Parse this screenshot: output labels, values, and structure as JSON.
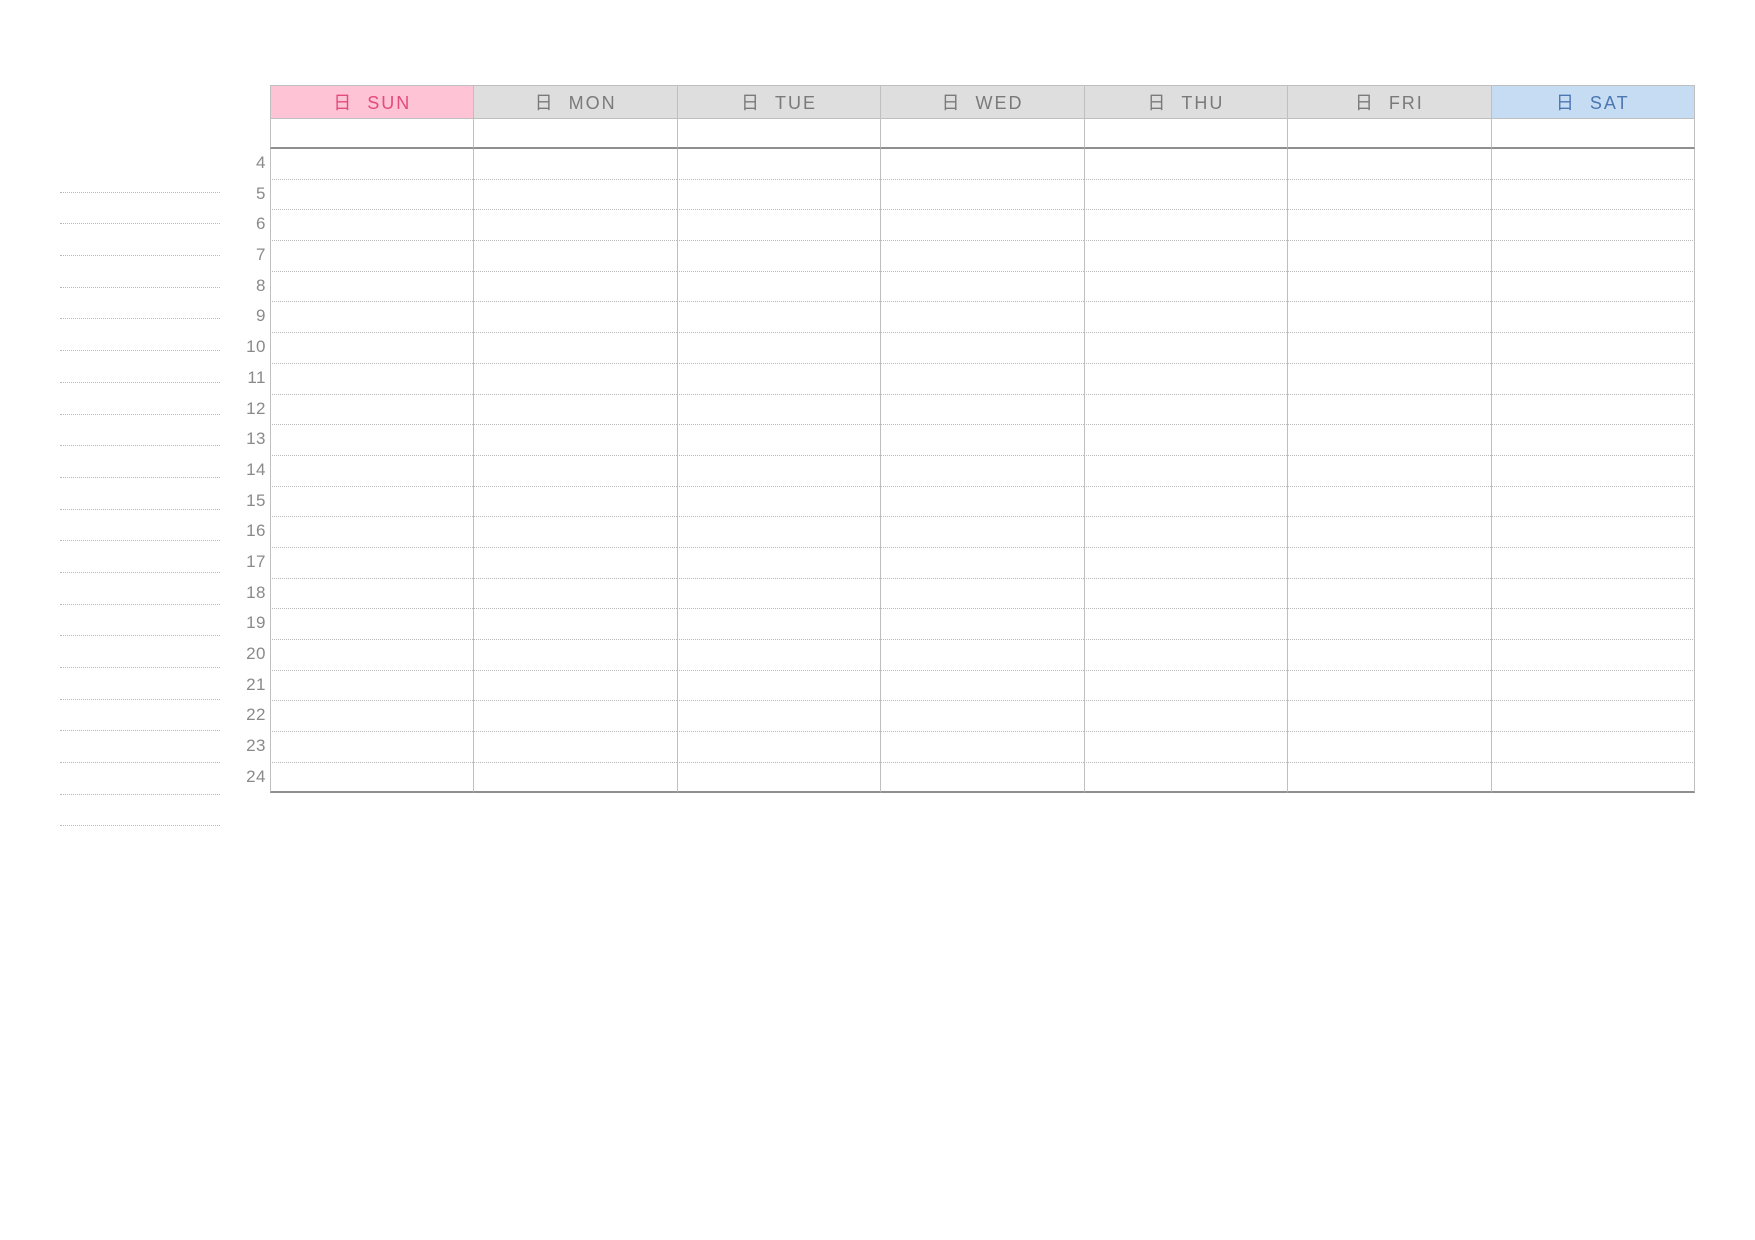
{
  "days": [
    {
      "key": "sun",
      "jp": "日",
      "en": "SUN"
    },
    {
      "key": "mon",
      "jp": "日",
      "en": "MON"
    },
    {
      "key": "tue",
      "jp": "日",
      "en": "TUE"
    },
    {
      "key": "wed",
      "jp": "日",
      "en": "WED"
    },
    {
      "key": "thu",
      "jp": "日",
      "en": "THU"
    },
    {
      "key": "fri",
      "jp": "日",
      "en": "FRI"
    },
    {
      "key": "sat",
      "jp": "日",
      "en": "SAT"
    }
  ],
  "hours": [
    "4",
    "5",
    "6",
    "7",
    "8",
    "9",
    "10",
    "11",
    "12",
    "13",
    "14",
    "15",
    "16",
    "17",
    "18",
    "19",
    "20",
    "21",
    "22",
    "23",
    "24"
  ],
  "note_lines": 21
}
